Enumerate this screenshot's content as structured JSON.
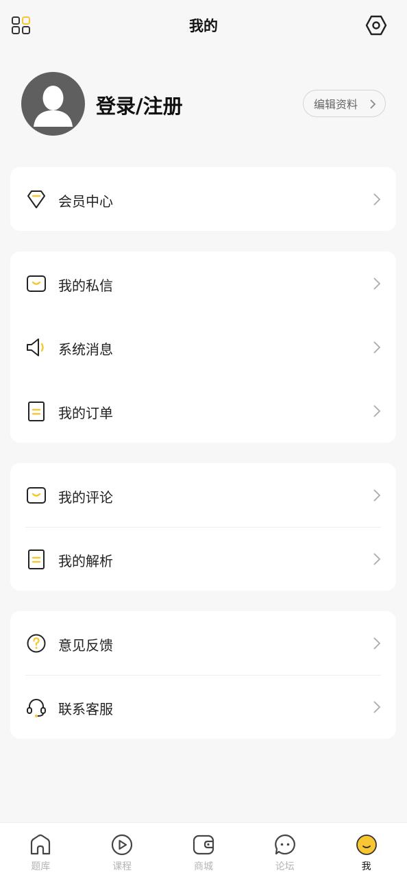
{
  "header": {
    "title": "我的",
    "grid_icon": "grid-icon",
    "settings_icon": "gear-icon"
  },
  "profile": {
    "login_label": "登录/注册",
    "edit_label": "编辑资料"
  },
  "colors": {
    "accent": "#f8c632",
    "background": "#f7f7f7",
    "card": "#ffffff"
  },
  "cards": [
    {
      "items": [
        {
          "label": "会员中心",
          "icon": "diamond-icon"
        }
      ]
    },
    {
      "items": [
        {
          "label": "我的私信",
          "icon": "message-box-icon"
        },
        {
          "label": "系统消息",
          "icon": "speaker-icon"
        },
        {
          "label": "我的订单",
          "icon": "order-doc-icon"
        }
      ]
    },
    {
      "items": [
        {
          "label": "我的评论",
          "icon": "comment-box-icon"
        },
        {
          "label": "我的解析",
          "icon": "analysis-doc-icon"
        }
      ]
    },
    {
      "items": [
        {
          "label": "意见反馈",
          "icon": "question-circle-icon"
        },
        {
          "label": "联系客服",
          "icon": "headset-icon"
        }
      ]
    }
  ],
  "tabbar": [
    {
      "label": "题库",
      "icon": "home-icon"
    },
    {
      "label": "课程",
      "icon": "play-circle-icon"
    },
    {
      "label": "商城",
      "icon": "wallet-icon"
    },
    {
      "label": "论坛",
      "icon": "chat-bubble-icon"
    },
    {
      "label": "我",
      "icon": "smile-face-icon",
      "active": true
    }
  ]
}
